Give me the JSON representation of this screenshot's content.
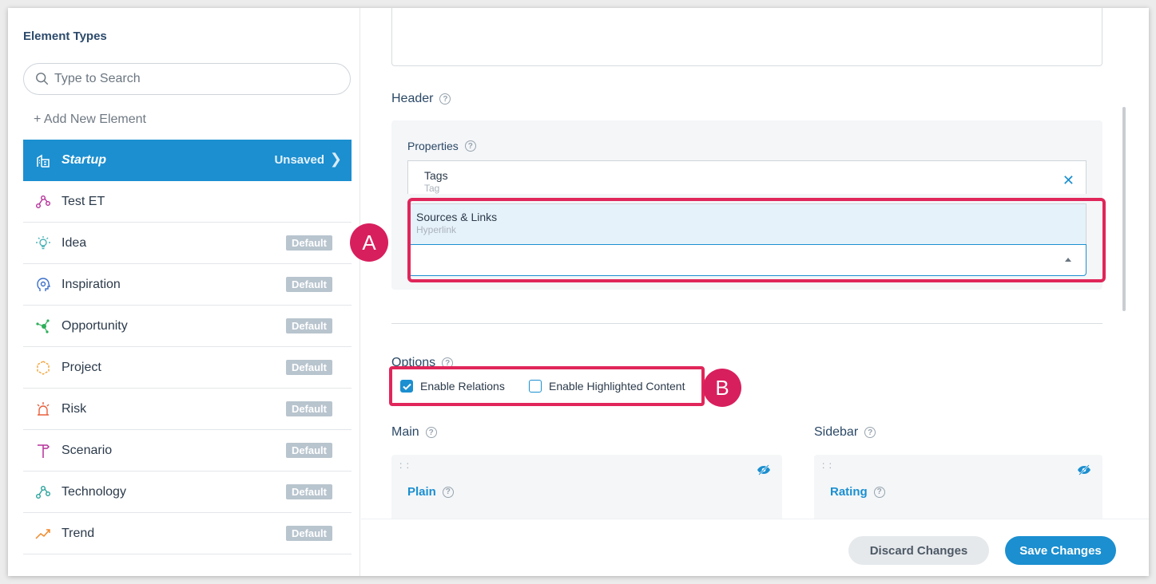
{
  "sidebar": {
    "title": "Element Types",
    "search_placeholder": "Type to Search",
    "add_new": "+ Add New Element",
    "items": [
      {
        "label": "Startup",
        "status": "Unsaved",
        "icon": "building-icon",
        "active": true
      },
      {
        "label": "Test ET",
        "badge": "",
        "icon": "nodes-icon",
        "color": "#b5329a"
      },
      {
        "label": "Idea",
        "badge": "Default",
        "icon": "lightbulb-icon",
        "color": "#4bb3b8"
      },
      {
        "label": "Inspiration",
        "badge": "Default",
        "icon": "head-gear-icon",
        "color": "#3b6fc9"
      },
      {
        "label": "Opportunity",
        "badge": "Default",
        "icon": "network-icon",
        "color": "#2fae5a"
      },
      {
        "label": "Project",
        "badge": "Default",
        "icon": "hexagon-icon",
        "color": "#f0a53a"
      },
      {
        "label": "Risk",
        "badge": "Default",
        "icon": "alarm-icon",
        "color": "#e8603c"
      },
      {
        "label": "Scenario",
        "badge": "Default",
        "icon": "signpost-icon",
        "color": "#b5329a"
      },
      {
        "label": "Technology",
        "badge": "Default",
        "icon": "nodes-icon",
        "color": "#2ba29c"
      },
      {
        "label": "Trend",
        "badge": "Default",
        "icon": "trend-icon",
        "color": "#f08a2c"
      }
    ]
  },
  "main": {
    "header_title": "Header",
    "properties_title": "Properties",
    "selected_property": {
      "name": "Tags",
      "type": "Tag"
    },
    "dropdown_option": {
      "name": "Sources & Links",
      "type": "Hyperlink"
    },
    "options_title": "Options",
    "option_relations": "Enable Relations",
    "option_highlighted": "Enable Highlighted Content",
    "main_title": "Main",
    "sidebar_title": "Sidebar",
    "main_field": "Plain",
    "sidebar_field": "Rating"
  },
  "annotations": {
    "a": "A",
    "b": "B",
    "color": "#e0265a"
  },
  "footer": {
    "discard": "Discard Changes",
    "save": "Save Changes"
  },
  "colors": {
    "accent": "#1b8fd0",
    "badge": "#b8c4ce"
  }
}
